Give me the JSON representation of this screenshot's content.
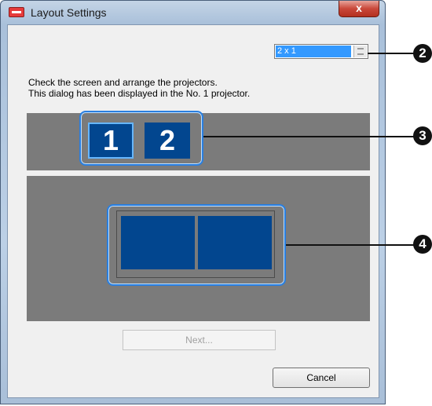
{
  "window": {
    "title": "Layout Settings",
    "close_label": "x"
  },
  "layout_select": {
    "value": "2 x 1"
  },
  "instructions": {
    "line1": "Check the screen and arrange the projectors.",
    "line2": "This dialog has been displayed in the No. 1 projector."
  },
  "projectors": [
    {
      "label": "1",
      "selected": true
    },
    {
      "label": "2",
      "selected": false
    }
  ],
  "buttons": {
    "next": "Next...",
    "cancel": "Cancel"
  },
  "callouts": [
    "2",
    "3",
    "4"
  ],
  "colors": {
    "tile_blue": "#02468f",
    "panel_grey": "#7b7b7b",
    "selection_blue": "#3399ff",
    "highlight_blue": "#2a7fe0"
  }
}
